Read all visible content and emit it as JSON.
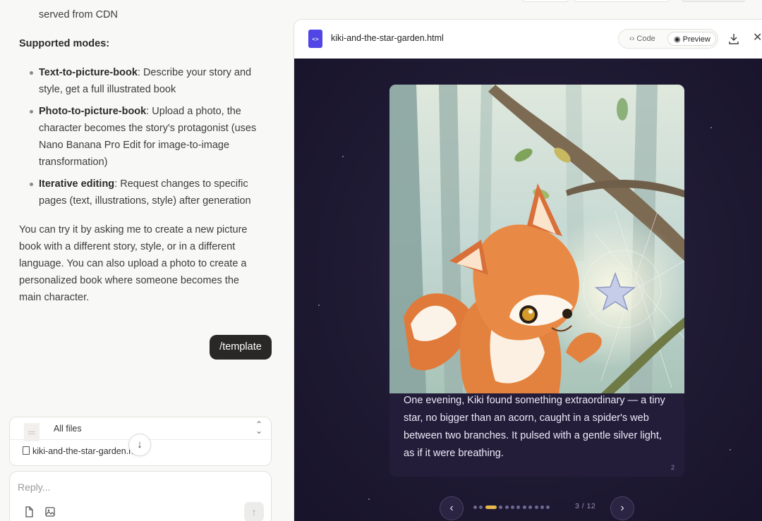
{
  "chat": {
    "line_cdn": "served from CDN",
    "modes_heading": "Supported modes:",
    "modes": [
      {
        "title": "Text-to-picture-book",
        "desc_line1": ": Describe your story and",
        "desc_line2": "style, get a full illustrated book"
      },
      {
        "title": "Photo-to-picture-book",
        "desc_line1": ": Upload a photo, the",
        "desc_line2": "character becomes the story's protagonist (uses",
        "desc_line3": "Nano Banana Pro Edit for image-to-image",
        "desc_line4": "transformation)"
      },
      {
        "title": "Iterative editing",
        "desc_line1": ": Request changes to specific",
        "desc_line2": "pages (text, illustrations, style) after generation"
      }
    ],
    "para": [
      "You can try it by asking me to create a new picture",
      "book with a different story, style, or in a different",
      "language. You can also upload a photo to create a",
      "personalized book where someone becomes the",
      "main character."
    ],
    "user_message": "/template",
    "files": {
      "header": "All files",
      "item": "kiki-and-the-star-garden.html"
    },
    "reply_placeholder": "Reply..."
  },
  "preview": {
    "filename": "kiki-and-the-star-garden.html",
    "tab_code": "Code",
    "tab_preview": "Preview",
    "active_tab": "Preview",
    "book": {
      "story_lines": [
        "One evening, Kiki found something extraordinary — a tiny",
        "star, no bigger than an acorn, caught in a spider's web",
        "between two branches. It pulsed with a gentle silver light,",
        "as if it were breathing."
      ],
      "page_number": "2",
      "page_counter": "3 / 12",
      "current_page": 3,
      "total_pages": 12
    }
  },
  "colors": {
    "accent_gold": "#e5b84b",
    "stage_bg": "#1f1a33",
    "user_bubble": "#2a2826",
    "file_icon": "#4f46e5"
  }
}
